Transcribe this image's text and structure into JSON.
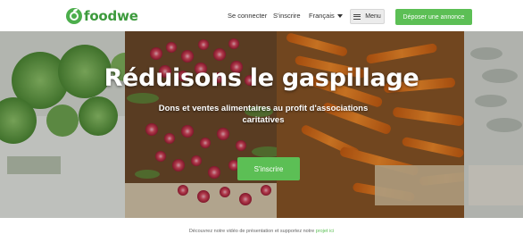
{
  "header": {
    "logo_text": "foodwe",
    "nav": {
      "login": "Se connecter",
      "signup": "S'inscrire",
      "language": "Français",
      "menu": "Menu"
    },
    "cta": "Déposer une annonce"
  },
  "hero": {
    "title": "Réduisons le gaspillage",
    "subtitle": "Dons et ventes alimentaires au profit d'associations caritatives",
    "cta": "S'inscrire"
  },
  "footer": {
    "text": "Découvrez notre vidéo de présentation et supportez notre",
    "link": "projet ici"
  },
  "colors": {
    "brand_green": "#5cbf55",
    "logo_green": "#3c9a3c",
    "text_dark": "#333333"
  },
  "icons": [
    "logo-leaf-icon",
    "caret-down-icon",
    "hamburger-icon"
  ]
}
